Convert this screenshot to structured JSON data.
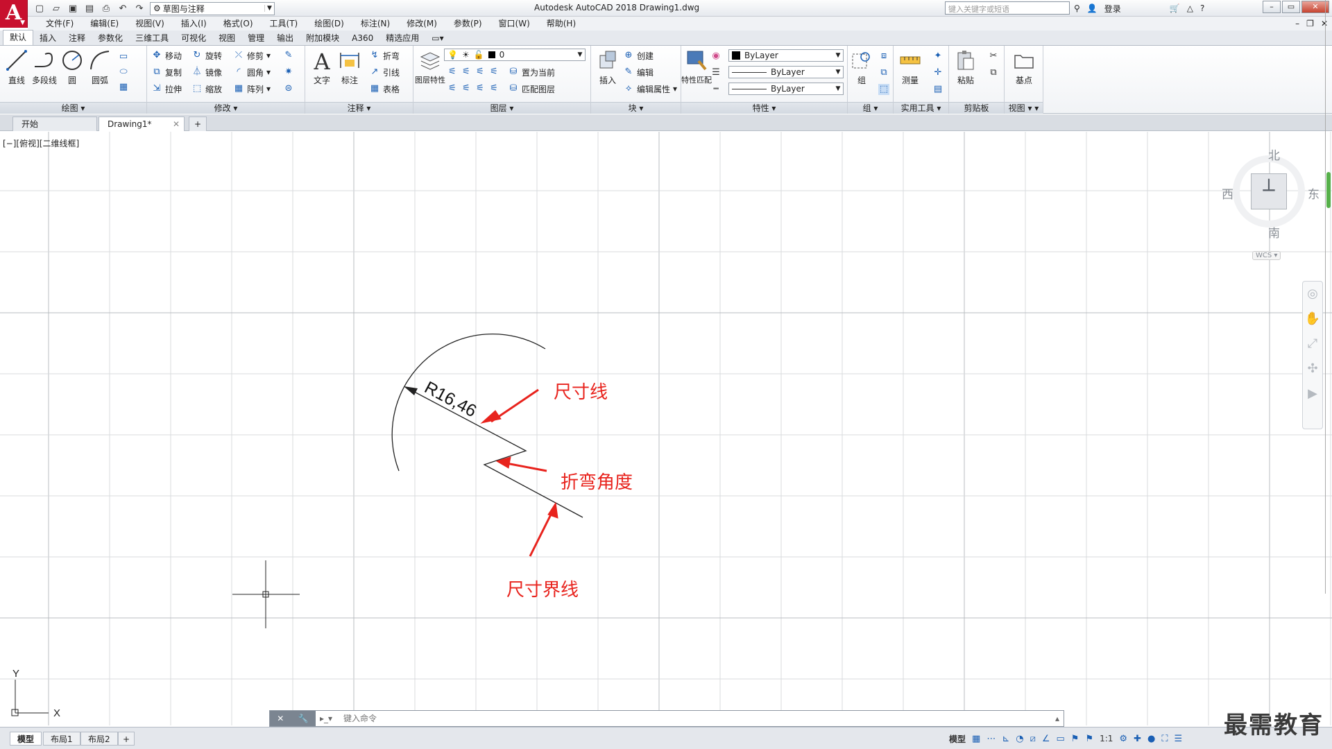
{
  "titlebar": {
    "app_letter": "A",
    "workspace": "草图与注释",
    "title": "Autodesk AutoCAD 2018    Drawing1.dwg",
    "search_placeholder": "键入关键字或短语",
    "login": "登录"
  },
  "menubar": {
    "items": [
      "文件(F)",
      "编辑(E)",
      "视图(V)",
      "插入(I)",
      "格式(O)",
      "工具(T)",
      "绘图(D)",
      "标注(N)",
      "修改(M)",
      "参数(P)",
      "窗口(W)",
      "帮助(H)"
    ]
  },
  "ribbon_tabs": {
    "items": [
      "默认",
      "插入",
      "注释",
      "参数化",
      "三维工具",
      "可视化",
      "视图",
      "管理",
      "输出",
      "附加模块",
      "A360",
      "精选应用"
    ],
    "active": "默认"
  },
  "ribbon": {
    "draw": {
      "title": "绘图",
      "line": "直线",
      "polyline": "多段线",
      "circle": "圆",
      "arc": "圆弧"
    },
    "modify": {
      "title": "修改",
      "move": "移动",
      "rotate": "旋转",
      "trim": "修剪",
      "copy": "复制",
      "mirror": "镜像",
      "fillet": "圆角",
      "stretch": "拉伸",
      "scale": "缩放",
      "array": "阵列"
    },
    "annotation": {
      "title": "注释",
      "text": "文字",
      "dimension": "标注",
      "jogged": "折弯",
      "leader": "引线",
      "table": "表格"
    },
    "layers": {
      "title": "图层",
      "layer_props": "图层特性",
      "current_layer": "0",
      "set_current": "置为当前",
      "match_layer": "匹配图层"
    },
    "block": {
      "title": "块",
      "insert": "插入",
      "create": "创建",
      "edit": "编辑",
      "edit_attr": "编辑属性"
    },
    "properties": {
      "title": "特性",
      "match": "特性匹配",
      "color": "ByLayer",
      "linetype": "ByLayer",
      "lineweight": "ByLayer"
    },
    "groups": {
      "title": "组",
      "group": "组"
    },
    "utilities": {
      "title": "实用工具",
      "measure": "测量"
    },
    "clipboard": {
      "title": "剪贴板",
      "paste": "粘贴"
    },
    "view": {
      "title": "视图",
      "base": "基点"
    }
  },
  "doc_tabs": {
    "start": "开始",
    "drawing": "Drawing1*"
  },
  "viewport": {
    "label": "[−][俯视][二维线框]"
  },
  "drawing": {
    "dim_text": "R16,46",
    "annotations": {
      "dim_line": "尺寸线",
      "jog_angle": "折弯角度",
      "ext_line": "尺寸界线"
    },
    "ucs": {
      "x": "X",
      "y": "Y"
    }
  },
  "viewcube": {
    "north": "北",
    "south": "南",
    "east": "东",
    "west": "西",
    "wcs": "WCS"
  },
  "command": {
    "placeholder": "键入命令"
  },
  "layout_tabs": {
    "model": "模型",
    "layout1": "布局1",
    "layout2": "布局2"
  },
  "status": {
    "model": "模型",
    "scale": "1:1"
  },
  "watermark": "最需教育",
  "colors": {
    "accent": "#1a5fb4",
    "annotation": "#e8231d",
    "logo": "#c8102e"
  }
}
